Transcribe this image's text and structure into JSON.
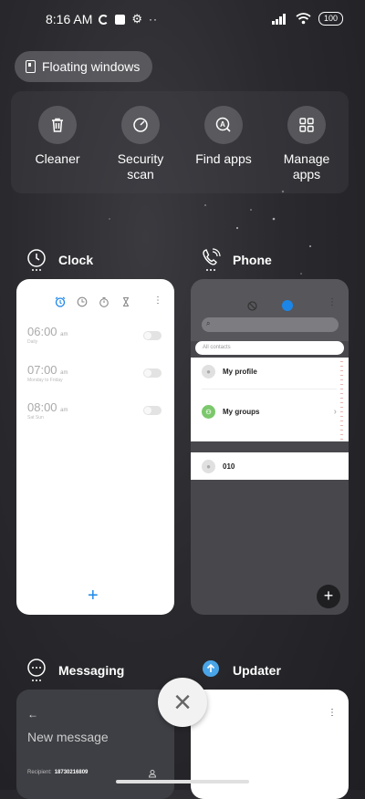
{
  "status_bar": {
    "time": "8:16 AM",
    "battery": "100"
  },
  "floating_windows": {
    "label": "Floating windows"
  },
  "quick_actions": [
    {
      "label": "Cleaner",
      "icon": "trash-icon"
    },
    {
      "label": "Security\nscan",
      "icon": "security-scan-icon"
    },
    {
      "label": "Find apps",
      "icon": "find-apps-icon"
    },
    {
      "label": "Manage\napps",
      "icon": "grid-icon"
    }
  ],
  "apps": {
    "clock": {
      "title": "Clock",
      "alarms": [
        {
          "time": "06:00",
          "ampm": "am",
          "label": "Daily"
        },
        {
          "time": "07:00",
          "ampm": "am",
          "label": "Monday to Friday"
        },
        {
          "time": "08:00",
          "ampm": "am",
          "label": "Sat Sun"
        }
      ],
      "add_label": "+"
    },
    "phone": {
      "title": "Phone",
      "filter_label": "All contacts",
      "rows": [
        {
          "label": "My profile"
        },
        {
          "label": "My groups"
        },
        {
          "label": "010"
        }
      ],
      "add_label": "+"
    },
    "messaging": {
      "title": "Messaging",
      "back_label": "←",
      "heading": "New message",
      "recipient_label": "Recipient:",
      "recipient_value": "18730216809"
    },
    "updater": {
      "title": "Updater"
    }
  },
  "close_label": "×"
}
